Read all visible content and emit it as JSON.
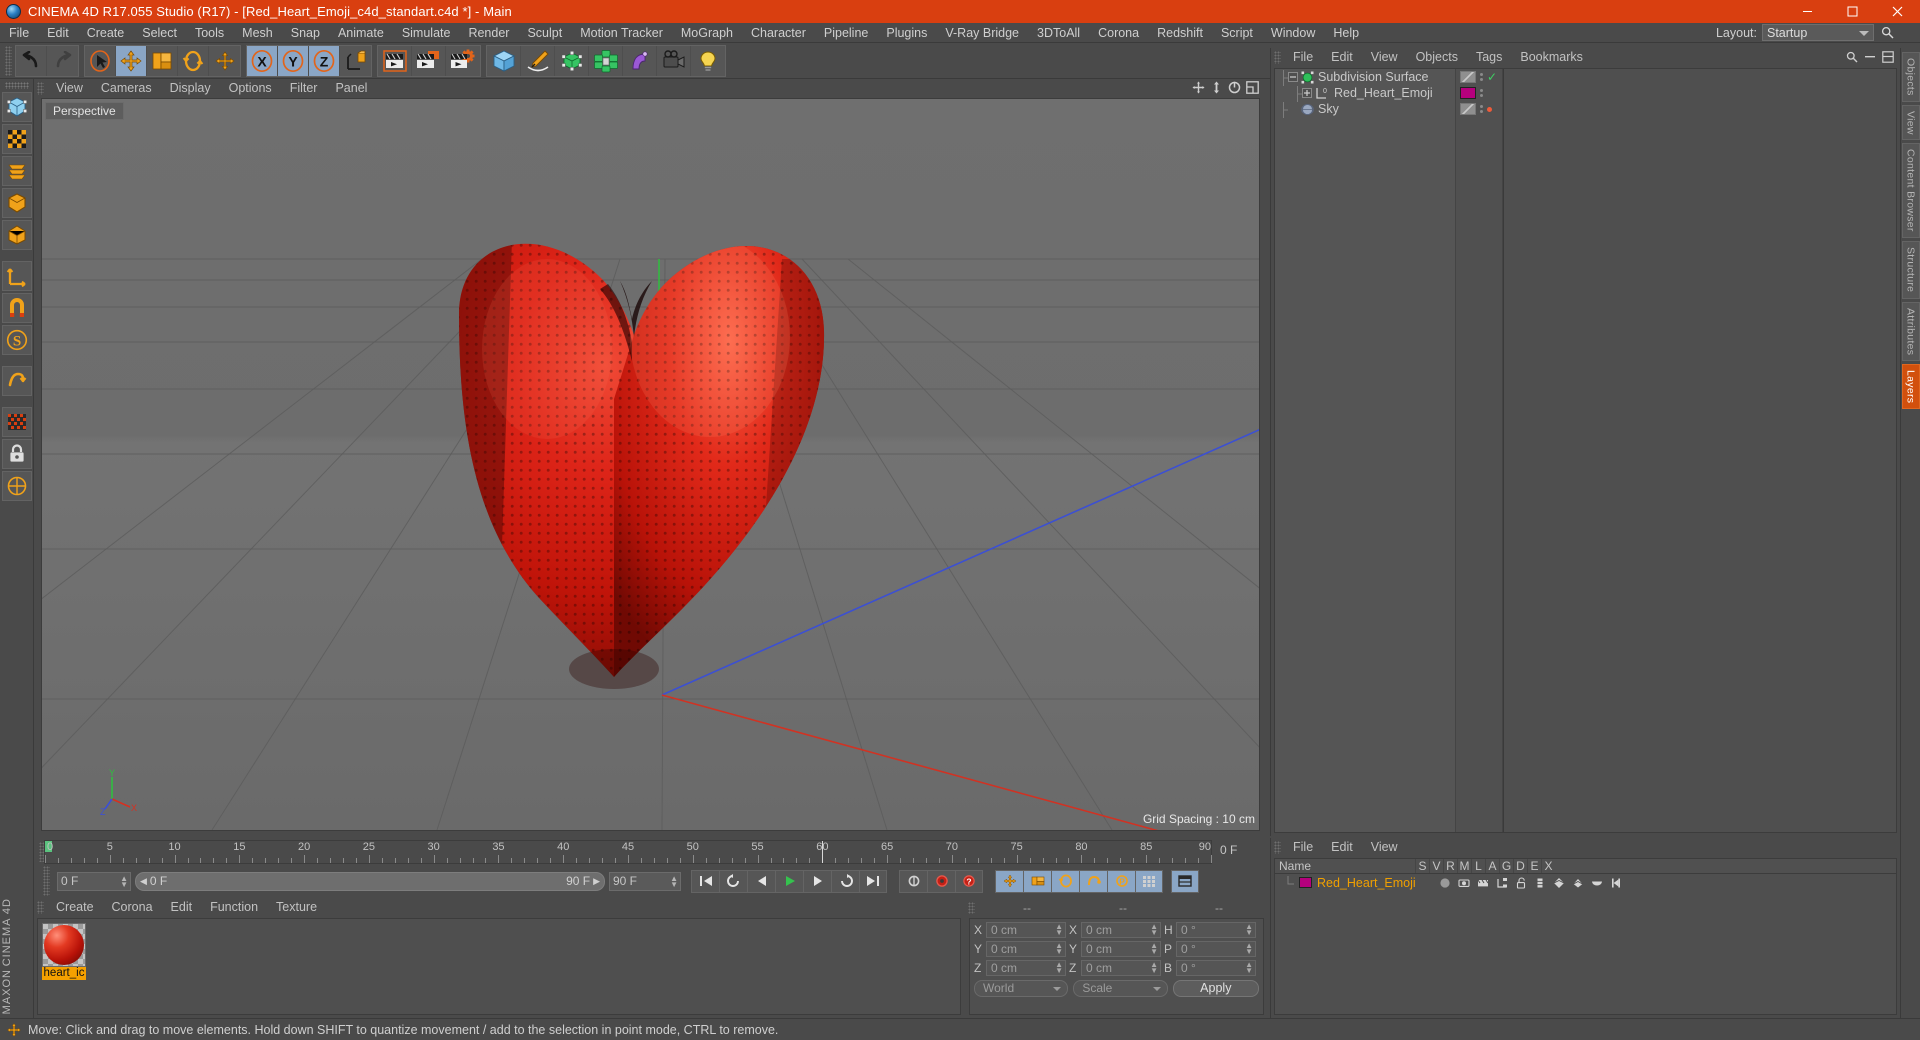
{
  "window": {
    "title": "CINEMA 4D R17.055 Studio (R17) - [Red_Heart_Emoji_c4d_standart.c4d *] - Main",
    "minimize": "minimize-icon",
    "maximize": "maximize-icon",
    "close": "close-icon"
  },
  "menubar": {
    "items": [
      "File",
      "Edit",
      "Create",
      "Select",
      "Tools",
      "Mesh",
      "Snap",
      "Animate",
      "Simulate",
      "Render",
      "Sculpt",
      "Motion Tracker",
      "MoGraph",
      "Character",
      "Pipeline",
      "Plugins",
      "V-Ray Bridge",
      "3DToAll",
      "Corona",
      "Redshift",
      "Script",
      "Window",
      "Help"
    ],
    "layout_label": "Layout:",
    "layout_value": "Startup",
    "search_icon": "search-icon"
  },
  "toolbar": {
    "groups": [
      {
        "name": "history",
        "buttons": [
          {
            "id": "undo",
            "icon": "undo-arrow-icon",
            "active": false
          },
          {
            "id": "redo",
            "icon": "redo-arrow-icon",
            "active": false
          }
        ]
      },
      {
        "name": "transform",
        "buttons": [
          {
            "id": "live-selection",
            "icon": "cursor-selection-icon",
            "active": false
          },
          {
            "id": "move",
            "icon": "move-arrows-icon",
            "active": true
          },
          {
            "id": "scale",
            "icon": "scale-box-icon",
            "active": false
          },
          {
            "id": "rotate",
            "icon": "rotate-circle-icon",
            "active": false
          },
          {
            "id": "move-duplicate",
            "icon": "move-arrows-icon",
            "active": false
          }
        ]
      },
      {
        "name": "axis-lock",
        "buttons": [
          {
            "id": "lock-x",
            "icon": "axis-x-icon",
            "active": true
          },
          {
            "id": "lock-y",
            "icon": "axis-y-icon",
            "active": true
          },
          {
            "id": "lock-z",
            "icon": "axis-z-icon",
            "active": true
          },
          {
            "id": "world-object-coords",
            "icon": "world-axis-icon",
            "active": false
          }
        ]
      },
      {
        "name": "render",
        "buttons": [
          {
            "id": "render-view",
            "icon": "render-clapper-icon",
            "active": false
          },
          {
            "id": "render-to-picture-viewer",
            "icon": "render-picture-icon",
            "active": false
          },
          {
            "id": "render-settings",
            "icon": "render-settings-gear-icon",
            "active": false
          }
        ]
      },
      {
        "name": "create",
        "buttons": [
          {
            "id": "add-cube",
            "icon": "cube-primitive-icon",
            "active": false
          },
          {
            "id": "add-spline",
            "icon": "pen-spline-icon",
            "active": false
          },
          {
            "id": "add-generator",
            "icon": "nurbs-green-icon",
            "active": false
          },
          {
            "id": "add-array",
            "icon": "array-cluster-icon",
            "active": false
          },
          {
            "id": "add-deformer",
            "icon": "deformer-bend-icon",
            "active": false
          },
          {
            "id": "add-camera",
            "icon": "camera-icon",
            "active": false
          },
          {
            "id": "add-light",
            "icon": "light-bulb-icon",
            "active": false
          }
        ]
      }
    ]
  },
  "left_palette": {
    "buttons": [
      {
        "id": "make-editable",
        "icon": "make-editable-cube-icon"
      },
      {
        "id": "model-mode",
        "icon": "model-mode-icon"
      },
      {
        "id": "texture-mode",
        "icon": "texture-checker-icon"
      },
      {
        "id": "point-mode",
        "icon": "points-mode-icon"
      },
      {
        "id": "edge-mode",
        "icon": "edge-mode-icon"
      },
      {
        "id": "polygon-mode",
        "icon": "polygon-mode-icon"
      },
      {
        "id": "enable-axis",
        "icon": "axis-modify-icon"
      },
      {
        "id": "enable-snapping",
        "icon": "magnet-snap-icon"
      },
      {
        "id": "workplane",
        "icon": "workplane-s-icon"
      },
      {
        "id": "viewport-solo",
        "icon": "solo-icon"
      },
      {
        "id": "texture-axis",
        "icon": "texture-axis-icon"
      },
      {
        "id": "lock-selection",
        "icon": "lock-icon"
      },
      {
        "id": "deformers-toggle",
        "icon": "deform-toggle-icon"
      }
    ],
    "brand_line1": "MAXON",
    "brand_line2": "CINEMA 4D"
  },
  "viewport": {
    "menu": [
      "View",
      "Cameras",
      "Display",
      "Options",
      "Filter",
      "Panel"
    ],
    "camera_label": "Perspective",
    "grid_spacing": "Grid Spacing : 10 cm",
    "axis_labels": {
      "x": "X",
      "y": "Y",
      "z": "Z"
    },
    "header_icons": [
      "pan-icon",
      "dolly-icon",
      "rotate-view-icon",
      "maximize-view-icon"
    ],
    "model_name": "Red_Heart_Emoji",
    "model_color": "#cc1f16"
  },
  "object_manager": {
    "menu": [
      "File",
      "Edit",
      "View",
      "Objects",
      "Tags",
      "Bookmarks"
    ],
    "header_icons": [
      "search-icon",
      "minimize-panel-icon",
      "layout-panel-icon"
    ],
    "items": [
      {
        "name": "Subdivision Surface",
        "icon": "subdivision-surface-icon",
        "indent": 0,
        "expander": "minus",
        "tag_swatch": "diagonal",
        "tag_check": true,
        "tag_color": null
      },
      {
        "name": "Red_Heart_Emoji",
        "icon": "polygon-object-icon",
        "indent": 1,
        "expander": "plus",
        "tag_swatch": "solid",
        "tag_check": false,
        "tag_color": "#b5007d"
      },
      {
        "name": "Sky",
        "icon": "sky-sphere-icon",
        "indent": 0,
        "expander": "none",
        "tag_swatch": "diagonal",
        "tag_check": false,
        "tag_color": "#ef5b3a"
      }
    ]
  },
  "timeline": {
    "ticks": [
      0,
      5,
      10,
      15,
      20,
      25,
      30,
      35,
      40,
      45,
      50,
      55,
      60,
      65,
      70,
      75,
      80,
      85,
      90
    ],
    "min": 0,
    "max": 90,
    "current_frame_label": "0 F",
    "playhead_frame": 0,
    "marker_frame": 60
  },
  "animation_bar": {
    "current_frame": "0 F",
    "range_start": "0 F",
    "range_end": "90 F",
    "end_frame_field": "90 F",
    "transport": [
      {
        "id": "go-to-start",
        "icon": "skip-start-icon"
      },
      {
        "id": "play-reverse-step",
        "icon": "rewind-loop-icon"
      },
      {
        "id": "step-back",
        "icon": "step-back-icon"
      },
      {
        "id": "play",
        "icon": "play-icon"
      },
      {
        "id": "step-forward",
        "icon": "step-forward-icon"
      },
      {
        "id": "loop-play",
        "icon": "loop-icon"
      },
      {
        "id": "go-to-end",
        "icon": "skip-end-icon"
      }
    ],
    "keyframe_tools": [
      {
        "id": "autokey",
        "icon": "autokey-icon"
      },
      {
        "id": "record-active",
        "icon": "record-red-icon"
      },
      {
        "id": "keyframe-selection",
        "icon": "keyframe-question-icon"
      },
      {
        "id": "record-position",
        "icon": "position-key-icon"
      },
      {
        "id": "record-scale",
        "icon": "scale-key-icon"
      },
      {
        "id": "record-rotation",
        "icon": "rotation-key-icon"
      },
      {
        "id": "record-pla",
        "icon": "pla-key-icon"
      },
      {
        "id": "record-param",
        "icon": "param-key-icon"
      },
      {
        "id": "timeline-toggle",
        "icon": "timeline-panel-icon"
      }
    ]
  },
  "material_manager": {
    "menu": [
      "Create",
      "Corona",
      "Edit",
      "Function",
      "Texture"
    ],
    "materials": [
      {
        "name": "heart_ic",
        "preview": "red-glossy-sphere",
        "selected": true
      }
    ]
  },
  "coordinates": {
    "headers": [
      "--",
      "--",
      "--"
    ],
    "rows": [
      {
        "pos_label": "X",
        "pos_value": "0 cm",
        "size_label": "X",
        "size_value": "0 cm",
        "rot_label": "H",
        "rot_value": "0 °"
      },
      {
        "pos_label": "Y",
        "pos_value": "0 cm",
        "size_label": "Y",
        "size_value": "0 cm",
        "rot_label": "P",
        "rot_value": "0 °"
      },
      {
        "pos_label": "Z",
        "pos_value": "0 cm",
        "size_label": "Z",
        "size_value": "0 cm",
        "rot_label": "B",
        "rot_value": "0 °"
      }
    ],
    "coord_system": "World",
    "transform_mode": "Scale",
    "apply_label": "Apply"
  },
  "attribute_panel": {
    "menu": [
      "File",
      "Edit",
      "View"
    ],
    "columns": [
      "Name",
      "S",
      "V",
      "R",
      "M",
      "L",
      "A",
      "G",
      "D",
      "E",
      "X"
    ],
    "rows": [
      {
        "name": "Red_Heart_Emoji",
        "swatch": "#b5007d",
        "icons": [
          "sphere-gray-icon",
          "visible-editor-icon",
          "visible-render-icon",
          "hierarchy-icon",
          "unlock-icon",
          "layers-icon",
          "deform-icon",
          "shade-icon",
          "cap-icon",
          "helper-icon"
        ]
      }
    ]
  },
  "right_tabs": [
    {
      "label": "Objects",
      "highlight": false
    },
    {
      "label": "View",
      "highlight": false
    },
    {
      "label": "Content Browser",
      "highlight": false
    },
    {
      "label": "Structure",
      "highlight": false
    },
    {
      "label": "Attributes",
      "highlight": false
    },
    {
      "label": "Layers",
      "highlight": true
    }
  ],
  "statusbar": {
    "icon": "move-tool-icon",
    "message": "Move: Click and drag to move elements. Hold down SHIFT to quantize movement / add to the selection in point mode, CTRL to remove."
  }
}
